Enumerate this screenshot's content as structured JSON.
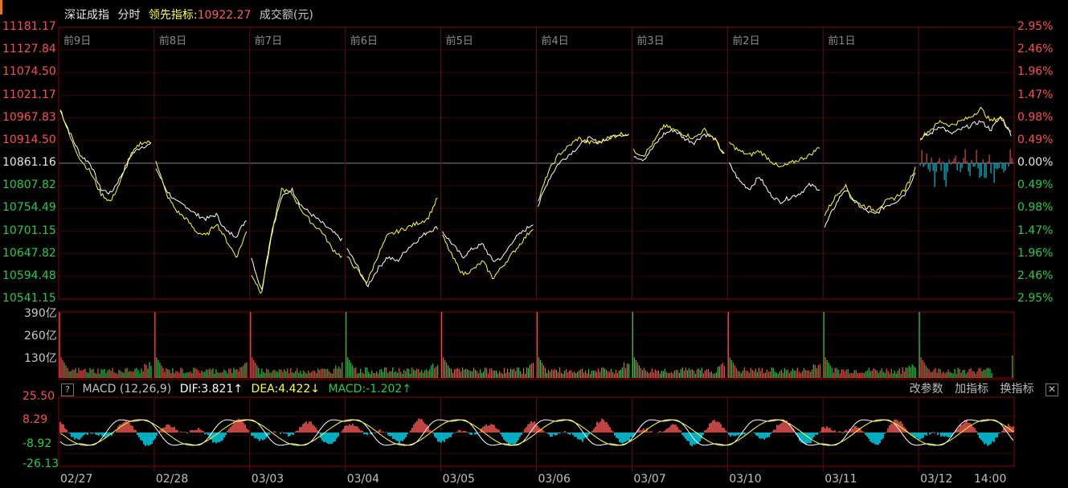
{
  "header": {
    "index_name": "深证成指",
    "view": "分时",
    "indicator_label": "领先指标:",
    "indicator_value": "10922.27",
    "volume_label": "成交额(元)"
  },
  "colors": {
    "up": "#ff4d4d",
    "down": "#22cc44",
    "neutral": "#e6e6e6",
    "price_line": "#ffffff",
    "leading_line": "#ffff33",
    "macd_pos": "#ff5a5a",
    "macd_neg": "#00e5ff",
    "grid": "#3a0000",
    "axis": "#8b0000"
  },
  "price_axis": {
    "left": [
      "11181.17",
      "11127.84",
      "11074.50",
      "11021.17",
      "10967.83",
      "10914.50",
      "10861.16",
      "10807.82",
      "10754.49",
      "10701.15",
      "10647.82",
      "10594.48",
      "10541.15"
    ],
    "right": [
      "2.95%",
      "2.46%",
      "1.96%",
      "1.47%",
      "0.98%",
      "0.49%",
      "0.00%",
      "0.49%",
      "0.98%",
      "1.47%",
      "1.96%",
      "2.46%",
      "2.95%"
    ]
  },
  "day_tags": [
    "前9日",
    "前8日",
    "前7日",
    "前6日",
    "前5日",
    "前4日",
    "前3日",
    "前2日",
    "前1日"
  ],
  "volume_axis": [
    "390亿",
    "260亿",
    "130亿"
  ],
  "macd": {
    "title": "MACD (12,26,9)",
    "dif": "DIF:3.821↑",
    "dea": "DEA:4.422↓",
    "macd": "MACD:-1.202↑",
    "axis": [
      "25.50",
      "8.29",
      "-8.92",
      "-26.13"
    ],
    "tools": [
      "改参数",
      "加指标",
      "换指标"
    ],
    "close_icon": "✕"
  },
  "x_dates": [
    "02/27",
    "02/28",
    "03/03",
    "03/04",
    "03/05",
    "03/06",
    "03/07",
    "03/10",
    "03/11",
    "03/12",
    "14:00"
  ],
  "chart_data": {
    "type": "line",
    "title": "深证成指",
    "x": [
      "02/27",
      "02/28",
      "03/03",
      "03/04",
      "03/05",
      "03/06",
      "03/07",
      "03/10",
      "03/11",
      "03/12"
    ],
    "ylim": [
      10541.15,
      11181.17
    ],
    "base": 10861.16,
    "series": [
      {
        "name": "深证成指",
        "color": "#ffffff",
        "days": [
          [
            10985,
            10930,
            10880,
            10860,
            10800,
            10790,
            10830,
            10880,
            10900,
            10905
          ],
          [
            10850,
            10800,
            10770,
            10760,
            10740,
            10730,
            10740,
            10700,
            10690,
            10730
          ],
          [
            10640,
            10560,
            10700,
            10780,
            10800,
            10760,
            10740,
            10720,
            10700,
            10680
          ],
          [
            10660,
            10620,
            10570,
            10610,
            10640,
            10630,
            10660,
            10680,
            10700,
            10710
          ],
          [
            10700,
            10670,
            10640,
            10660,
            10670,
            10630,
            10640,
            10680,
            10700,
            10720
          ],
          [
            10760,
            10820,
            10860,
            10880,
            10900,
            10920,
            10910,
            10920,
            10930,
            10925
          ],
          [
            10880,
            10870,
            10900,
            10930,
            10940,
            10920,
            10910,
            10930,
            10920,
            10880
          ],
          [
            10860,
            10820,
            10800,
            10830,
            10790,
            10770,
            10780,
            10790,
            10810,
            10800
          ],
          [
            10710,
            10760,
            10800,
            10770,
            10750,
            10740,
            10760,
            10770,
            10790,
            10840
          ],
          [
            10920,
            10930,
            10950,
            10930,
            10940,
            10950,
            10960,
            10940,
            10970,
            10930
          ]
        ]
      },
      {
        "name": "领先指标",
        "color": "#ffff33",
        "days": [
          [
            10990,
            10920,
            10870,
            10840,
            10790,
            10770,
            10820,
            10880,
            10910,
            10910
          ],
          [
            10870,
            10790,
            10750,
            10730,
            10700,
            10690,
            10720,
            10680,
            10640,
            10700
          ],
          [
            10600,
            10555,
            10690,
            10800,
            10790,
            10750,
            10720,
            10700,
            10660,
            10640
          ],
          [
            10640,
            10610,
            10580,
            10640,
            10690,
            10700,
            10710,
            10720,
            10730,
            10780
          ],
          [
            10690,
            10640,
            10600,
            10610,
            10630,
            10590,
            10620,
            10650,
            10680,
            10710
          ],
          [
            10770,
            10840,
            10880,
            10900,
            10920,
            10910,
            10910,
            10920,
            10930,
            10930
          ],
          [
            10890,
            10880,
            10910,
            10950,
            10940,
            10930,
            10920,
            10940,
            10920,
            10880
          ],
          [
            10910,
            10890,
            10880,
            10890,
            10870,
            10850,
            10860,
            10870,
            10880,
            10900
          ],
          [
            10740,
            10780,
            10810,
            10770,
            10760,
            10750,
            10770,
            10780,
            10800,
            10850
          ],
          [
            10920,
            10940,
            10960,
            10950,
            10960,
            10970,
            10990,
            10960,
            10970,
            10935
          ]
        ]
      }
    ]
  }
}
